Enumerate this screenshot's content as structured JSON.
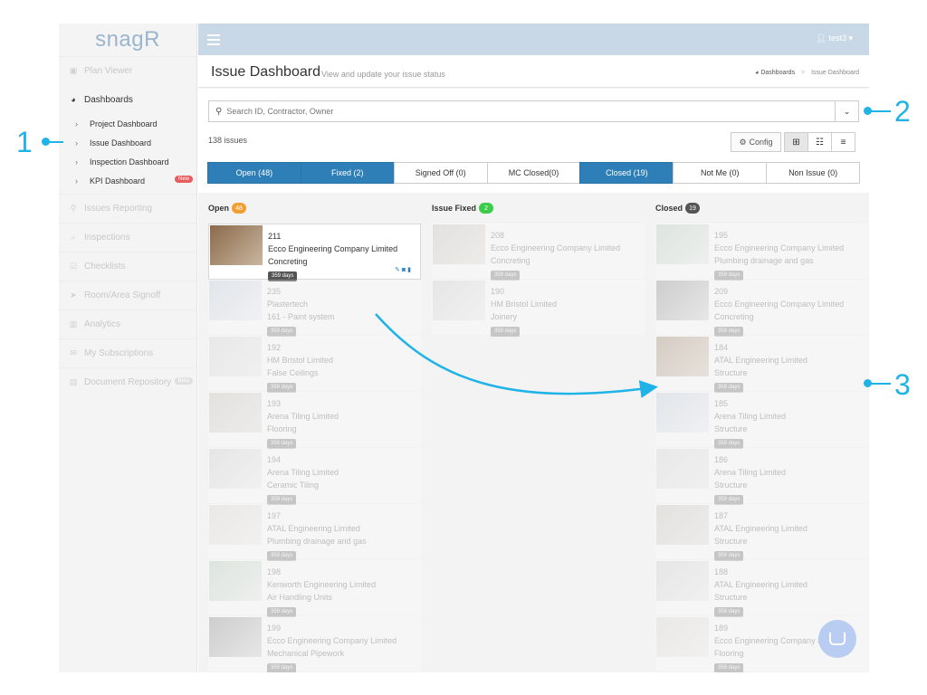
{
  "app": {
    "logo": "snagR"
  },
  "sidebar": {
    "items": [
      {
        "label": "Plan Viewer",
        "icon": "image-icon"
      },
      {
        "label": "Dashboards",
        "icon": "dashboard-icon"
      },
      {
        "label": "Issues Reporting",
        "icon": "pin-icon"
      },
      {
        "label": "Inspections",
        "icon": "search-icon"
      },
      {
        "label": "Checklists",
        "icon": "checklist-icon"
      },
      {
        "label": "Room/Area Signoff",
        "icon": "send-icon"
      },
      {
        "label": "Analytics",
        "icon": "chart-icon"
      },
      {
        "label": "My Subscriptions",
        "icon": "mail-icon"
      },
      {
        "label": "Document Repository",
        "icon": "document-icon",
        "badge": "Beta"
      }
    ],
    "sub_items": [
      {
        "label": "Project Dashboard"
      },
      {
        "label": "Issue Dashboard"
      },
      {
        "label": "Inspection Dashboard"
      },
      {
        "label": "KPI Dashboard",
        "badge": "New"
      }
    ]
  },
  "topbar": {
    "user": "test3"
  },
  "page": {
    "title": "Issue Dashboard",
    "subtitle": "View and update your issue status",
    "breadcrumb": [
      "Dashboards",
      "Issue Dashboard"
    ]
  },
  "search": {
    "placeholder": "Search ID, Contractor, Owner"
  },
  "issue_count": "138 issues",
  "config_label": "Config",
  "tabs": [
    {
      "label": "Open (48)",
      "active": true
    },
    {
      "label": "Fixed (2)",
      "active": true
    },
    {
      "label": "Signed Off (0)",
      "active": false
    },
    {
      "label": "MC Closed(0)",
      "active": false
    },
    {
      "label": "Closed (19)",
      "active": true
    },
    {
      "label": "Not Me (0)",
      "active": false
    },
    {
      "label": "Non Issue (0)",
      "active": false
    }
  ],
  "columns": [
    {
      "title": "Open",
      "count": "48",
      "color": "#f0a030",
      "cards": [
        {
          "id": "211",
          "company": "Ecco Engineering Company Limited",
          "trade": "Concreting",
          "days": "359 days"
        },
        {
          "id": "235",
          "company": "Plastertech",
          "trade": "161 - Paint system",
          "days": "359 days"
        },
        {
          "id": "192",
          "company": "HM Bristol Limited",
          "trade": "False Ceilings",
          "days": "359 days"
        },
        {
          "id": "193",
          "company": "Arena Tiling Limited",
          "trade": "Flooring",
          "days": "359 days"
        },
        {
          "id": "194",
          "company": "Arena Tiling Limited",
          "trade": "Ceramic Tiling",
          "days": "359 days"
        },
        {
          "id": "197",
          "company": "ATAL Engineering Limited",
          "trade": "Plumbing drainage and gas",
          "days": "359 days"
        },
        {
          "id": "198",
          "company": "Kenworth Engineering Limited",
          "trade": "Air Handling Units",
          "days": "359 days"
        },
        {
          "id": "199",
          "company": "Ecco Engineering Company Limited",
          "trade": "Mechanical Pipework",
          "days": "359 days"
        }
      ]
    },
    {
      "title": "Issue Fixed",
      "count": "2",
      "color": "#3ccc4a",
      "cards": [
        {
          "id": "208",
          "company": "Ecco Engineering Company Limited",
          "trade": "Concreting",
          "days": "359 days"
        },
        {
          "id": "190",
          "company": "HM Bristol Limited",
          "trade": "Joinery",
          "days": "359 days"
        }
      ]
    },
    {
      "title": "Closed",
      "count": "19",
      "color": "#555555",
      "cards": [
        {
          "id": "195",
          "company": "Ecco Engineering Company Limited",
          "trade": "Plumbing drainage and gas",
          "days": "359 days"
        },
        {
          "id": "209",
          "company": "Ecco Engineering Company Limited",
          "trade": "Concreting",
          "days": "359 days"
        },
        {
          "id": "184",
          "company": "ATAL Engineering Limited",
          "trade": "Structure",
          "days": "359 days"
        },
        {
          "id": "185",
          "company": "Arena Tiling Limited",
          "trade": "Structure",
          "days": "359 days"
        },
        {
          "id": "186",
          "company": "Arena Tiling Limited",
          "trade": "Structure",
          "days": "359 days"
        },
        {
          "id": "187",
          "company": "ATAL Engineering Limited",
          "trade": "Structure",
          "days": "359 days"
        },
        {
          "id": "188",
          "company": "ATAL Engineering Limited",
          "trade": "Structure",
          "days": "359 days"
        },
        {
          "id": "189",
          "company": "Ecco Engineering Company Limited",
          "trade": "Flooring",
          "days": "359 days"
        }
      ]
    }
  ],
  "annotations": {
    "one": "1",
    "two": "2",
    "three": "3"
  },
  "colors": {
    "accent": "#2e7fb8",
    "annotation": "#1fb3e8",
    "topbar": "#c9d8e6"
  }
}
